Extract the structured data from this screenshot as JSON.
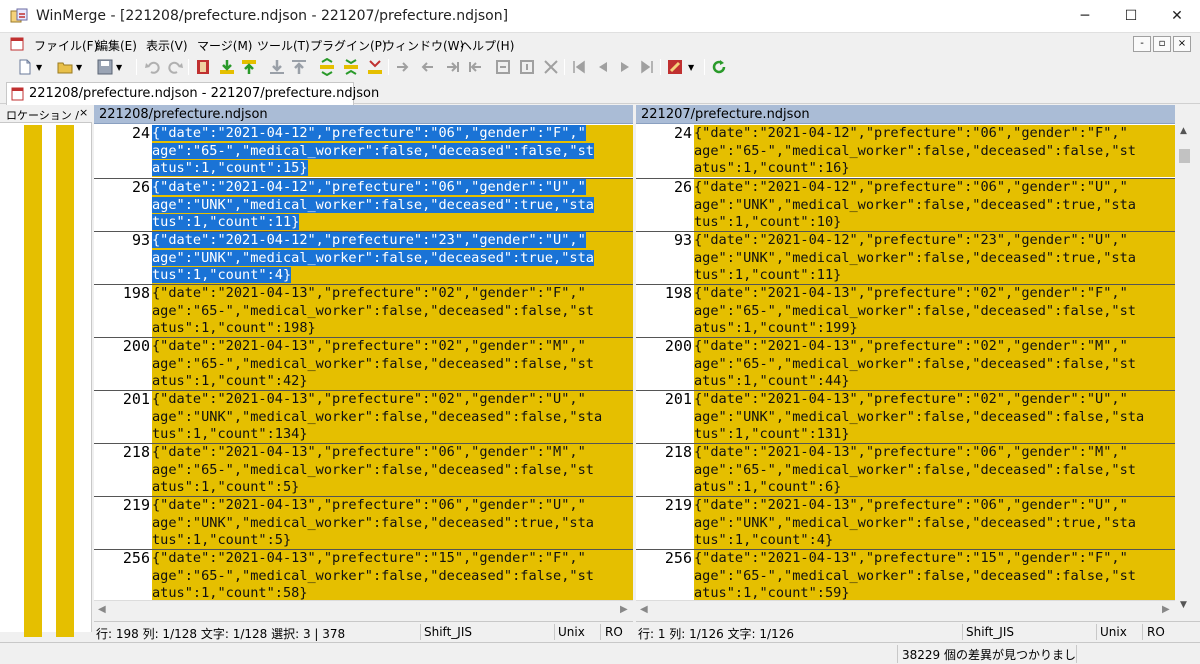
{
  "window": {
    "app_name": "WinMerge",
    "title": "WinMerge - [221208/prefecture.ndjson - 221207/prefecture.ndjson]",
    "controls": {
      "minimize": "─",
      "maximize": "☐",
      "close": "✕"
    }
  },
  "menu": {
    "items": [
      "ファイル(F)",
      "編集(E)",
      "表示(V)",
      "マージ(M)",
      "ツール(T)",
      "プラグイン(P)",
      "ウィンドウ(W)",
      "ヘルプ(H)"
    ],
    "mdi_controls": [
      "-",
      "▫",
      "×"
    ]
  },
  "toolbar": {
    "icons": [
      "new-icon",
      "open-icon",
      "save-icon",
      "undo-icon",
      "redo-icon",
      "film-icon",
      "copy-right-icon",
      "copy-left-icon",
      "copy-all-right-icon",
      "copy-all-left-icon",
      "next-diff-icon",
      "prev-diff-icon",
      "first-diff-icon",
      "last-diff-icon",
      "current-diff-icon",
      "nav-icons",
      "options-icon",
      "refresh-icon"
    ]
  },
  "tab": {
    "label": "221208/prefecture.ndjson - 221207/prefecture.ndjson"
  },
  "location_pane": {
    "title": "ロケーション /",
    "close": "×"
  },
  "left_pane": {
    "header": "221208/prefecture.ndjson",
    "rows": [
      {
        "num": "24",
        "lines": [
          "{\"date\":\"2021-04-12\",\"prefecture\":\"06\",\"gender\":\"F\",\"",
          "age\":\"65-\",\"medical_worker\":false,\"deceased\":false,\"st",
          "atus\":1,\"count\":15}"
        ],
        "selected": true
      },
      {
        "num": "26",
        "lines": [
          "{\"date\":\"2021-04-12\",\"prefecture\":\"06\",\"gender\":\"U\",\"",
          "age\":\"UNK\",\"medical_worker\":false,\"deceased\":true,\"sta",
          "tus\":1,\"count\":11}"
        ],
        "selected": true
      },
      {
        "num": "93",
        "lines": [
          "{\"date\":\"2021-04-12\",\"prefecture\":\"23\",\"gender\":\"U\",\"",
          "age\":\"UNK\",\"medical_worker\":false,\"deceased\":true,\"sta",
          "tus\":1,\"count\":4}"
        ],
        "selected": true
      },
      {
        "num": "198",
        "lines": [
          "{\"date\":\"2021-04-13\",\"prefecture\":\"02\",\"gender\":\"F\",\"",
          "age\":\"65-\",\"medical_worker\":false,\"deceased\":false,\"st",
          "atus\":1,\"count\":198}"
        ],
        "selected": false
      },
      {
        "num": "200",
        "lines": [
          "{\"date\":\"2021-04-13\",\"prefecture\":\"02\",\"gender\":\"M\",\"",
          "age\":\"65-\",\"medical_worker\":false,\"deceased\":false,\"st",
          "atus\":1,\"count\":42}"
        ],
        "selected": false
      },
      {
        "num": "201",
        "lines": [
          "{\"date\":\"2021-04-13\",\"prefecture\":\"02\",\"gender\":\"U\",\"",
          "age\":\"UNK\",\"medical_worker\":false,\"deceased\":false,\"sta",
          "tus\":1,\"count\":134}"
        ],
        "selected": false
      },
      {
        "num": "218",
        "lines": [
          "{\"date\":\"2021-04-13\",\"prefecture\":\"06\",\"gender\":\"M\",\"",
          "age\":\"65-\",\"medical_worker\":false,\"deceased\":false,\"st",
          "atus\":1,\"count\":5}"
        ],
        "selected": false
      },
      {
        "num": "219",
        "lines": [
          "{\"date\":\"2021-04-13\",\"prefecture\":\"06\",\"gender\":\"U\",\"",
          "age\":\"UNK\",\"medical_worker\":false,\"deceased\":true,\"sta",
          "tus\":1,\"count\":5}"
        ],
        "selected": false
      },
      {
        "num": "256",
        "lines": [
          "{\"date\":\"2021-04-13\",\"prefecture\":\"15\",\"gender\":\"F\",\"",
          "age\":\"65-\",\"medical_worker\":false,\"deceased\":false,\"st",
          "atus\":1,\"count\":58}"
        ],
        "selected": false
      }
    ]
  },
  "right_pane": {
    "header": "221207/prefecture.ndjson",
    "rows": [
      {
        "num": "24",
        "lines": [
          "{\"date\":\"2021-04-12\",\"prefecture\":\"06\",\"gender\":\"F\",\"",
          "age\":\"65-\",\"medical_worker\":false,\"deceased\":false,\"st",
          "atus\":1,\"count\":16}"
        ],
        "selected": false
      },
      {
        "num": "26",
        "lines": [
          "{\"date\":\"2021-04-12\",\"prefecture\":\"06\",\"gender\":\"U\",\"",
          "age\":\"UNK\",\"medical_worker\":false,\"deceased\":true,\"sta",
          "tus\":1,\"count\":10}"
        ],
        "selected": false
      },
      {
        "num": "93",
        "lines": [
          "{\"date\":\"2021-04-12\",\"prefecture\":\"23\",\"gender\":\"U\",\"",
          "age\":\"UNK\",\"medical_worker\":false,\"deceased\":true,\"sta",
          "tus\":1,\"count\":11}"
        ],
        "selected": false
      },
      {
        "num": "198",
        "lines": [
          "{\"date\":\"2021-04-13\",\"prefecture\":\"02\",\"gender\":\"F\",\"",
          "age\":\"65-\",\"medical_worker\":false,\"deceased\":false,\"st",
          "atus\":1,\"count\":199}"
        ],
        "selected": false
      },
      {
        "num": "200",
        "lines": [
          "{\"date\":\"2021-04-13\",\"prefecture\":\"02\",\"gender\":\"M\",\"",
          "age\":\"65-\",\"medical_worker\":false,\"deceased\":false,\"st",
          "atus\":1,\"count\":44}"
        ],
        "selected": false
      },
      {
        "num": "201",
        "lines": [
          "{\"date\":\"2021-04-13\",\"prefecture\":\"02\",\"gender\":\"U\",\"",
          "age\":\"UNK\",\"medical_worker\":false,\"deceased\":false,\"sta",
          "tus\":1,\"count\":131}"
        ],
        "selected": false
      },
      {
        "num": "218",
        "lines": [
          "{\"date\":\"2021-04-13\",\"prefecture\":\"06\",\"gender\":\"M\",\"",
          "age\":\"65-\",\"medical_worker\":false,\"deceased\":false,\"st",
          "atus\":1,\"count\":6}"
        ],
        "selected": false
      },
      {
        "num": "219",
        "lines": [
          "{\"date\":\"2021-04-13\",\"prefecture\":\"06\",\"gender\":\"U\",\"",
          "age\":\"UNK\",\"medical_worker\":false,\"deceased\":true,\"sta",
          "tus\":1,\"count\":4}"
        ],
        "selected": false
      },
      {
        "num": "256",
        "lines": [
          "{\"date\":\"2021-04-13\",\"prefecture\":\"15\",\"gender\":\"F\",\"",
          "age\":\"65-\",\"medical_worker\":false,\"deceased\":false,\"st",
          "atus\":1,\"count\":59}"
        ],
        "selected": false
      }
    ]
  },
  "left_status": {
    "position": "行: 198  列: 1/128  文字: 1/128  選択: 3 | 378",
    "encoding": "Shift_JIS",
    "eol": "Unix",
    "mode": "RO"
  },
  "right_status": {
    "position": "行: 1  列: 1/126  文字: 1/126",
    "encoding": "Shift_JIS",
    "eol": "Unix",
    "mode": "RO"
  },
  "status_message": "38229 個の差異が見つかりまし",
  "colors": {
    "diff_background": "#e5bf00",
    "selection": "#1a73d6",
    "pane_header": "#aabcd6"
  }
}
